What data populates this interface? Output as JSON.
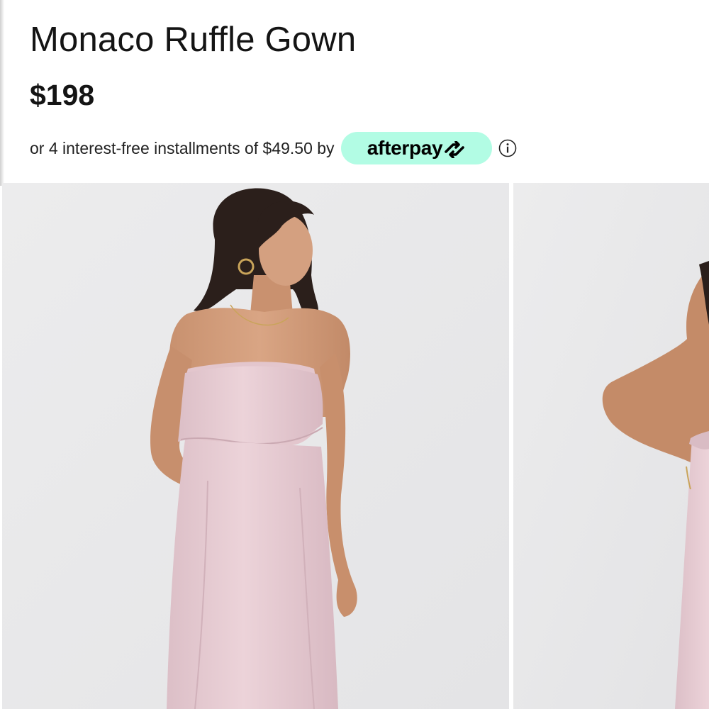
{
  "product": {
    "title": "Monaco Ruffle Gown",
    "price": "$198"
  },
  "afterpay": {
    "installment_text": "or 4 interest-free installments of $49.50 by",
    "logo_text": "afterpay",
    "badge_color": "#b2fce4",
    "info_icon": "info-icon"
  },
  "gallery": {
    "images": [
      {
        "alt": "model wearing blush strapless ruffle gown, front view"
      },
      {
        "alt": "model wearing blush strapless ruffle gown, back view"
      }
    ]
  },
  "colors": {
    "background": "#ffffff",
    "photo_background": "#e9e9e9",
    "dress": "#e8cdd4",
    "text": "#141414"
  }
}
